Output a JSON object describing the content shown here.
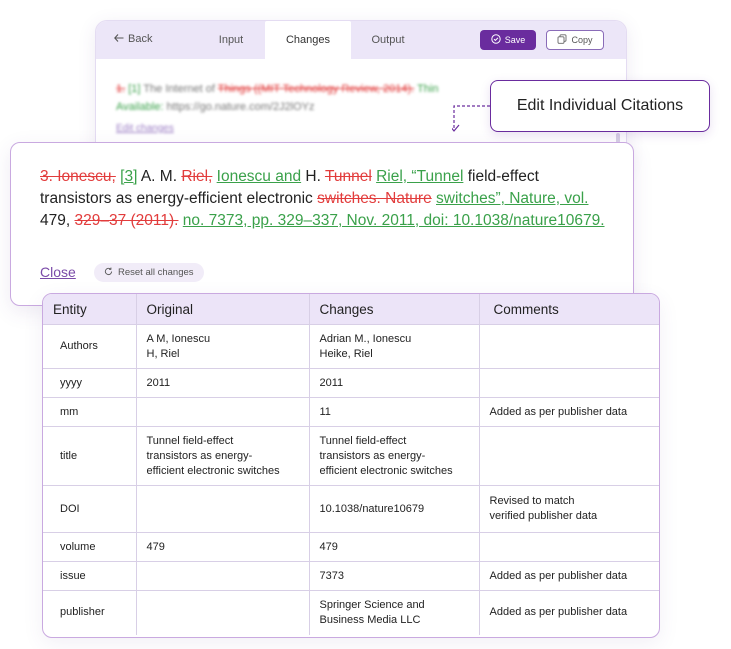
{
  "app": {
    "back_label": "Back",
    "tabs": [
      {
        "label": "Input"
      },
      {
        "label": "Changes"
      },
      {
        "label": "Output"
      }
    ],
    "save_label": "Save",
    "copy_label": "Copy",
    "bg_line1": {
      "num_old": "1.",
      "num_new": "[1]",
      "text_a": " The Internet of ",
      "del_text": "Things ((MIT Technology Review, 2014).",
      "ins_text": " Thin"
    },
    "bg_line2": {
      "ins_text": "Available:",
      "url": " https://go.nature.com/2J2lOYz"
    },
    "edit_changes_label": "Edit changes"
  },
  "tooltip": {
    "text": "Edit Individual Citations"
  },
  "citation": {
    "del_number": "3. Ionescu,",
    "ins_number": "[3]",
    "t1": " A. M. ",
    "del_riel": "Riel,",
    "ins_ionescu": "Ionescu and",
    "t2": " H. ",
    "del_tunnel": "Tunnel",
    "ins_riel_tunnel": "Riel, “Tunnel",
    "t3": " field-effect transistors as energy-efficient electronic ",
    "del_switches": "switches. Nature",
    "ins_switches": "switches”, Nature, vol.",
    "t4": " 479, ",
    "del_pages": "329–37 (2011).",
    "ins_pages": "no. 7373, pp. 329–337, Nov. 2011, doi: 10.1038/nature10679."
  },
  "card": {
    "close_label": "Close",
    "reset_label": "Reset all changes"
  },
  "table": {
    "headers": {
      "entity": "Entity",
      "original": "Original",
      "changes": "Changes",
      "comments": "Comments"
    },
    "rows": [
      {
        "entity": "Authors",
        "original": "A M, Ionescu\nH, Riel",
        "changes": "Adrian M., Ionescu\nHeike, Riel",
        "comments": ""
      },
      {
        "entity": "yyyy",
        "original": "2011",
        "changes": "2011",
        "comments": ""
      },
      {
        "entity": "mm",
        "original": "",
        "changes": "11",
        "comments": "Added as per publisher data"
      },
      {
        "entity": "title",
        "original": "Tunnel field-effect\ntransistors as energy-\nefficient electronic switches",
        "changes": "Tunnel field-effect\ntransistors as energy-\nefficient electronic switches",
        "comments": ""
      },
      {
        "entity": "DOI",
        "original": "",
        "changes": "10.1038/nature10679",
        "comments": "Revised to match\nverified publisher data"
      },
      {
        "entity": "volume",
        "original": "479",
        "changes": "479",
        "comments": ""
      },
      {
        "entity": "issue",
        "original": "",
        "changes": "7373",
        "comments": "Added as per publisher data"
      },
      {
        "entity": "publisher",
        "original": "",
        "changes": "Springer Science and\nBusiness Media LLC",
        "comments": "Added as per publisher data"
      }
    ]
  },
  "colors": {
    "accent": "#6a2c9e",
    "deleted": "#e23c3c",
    "inserted": "#3aa14a",
    "header_bg": "#ece4f8"
  }
}
